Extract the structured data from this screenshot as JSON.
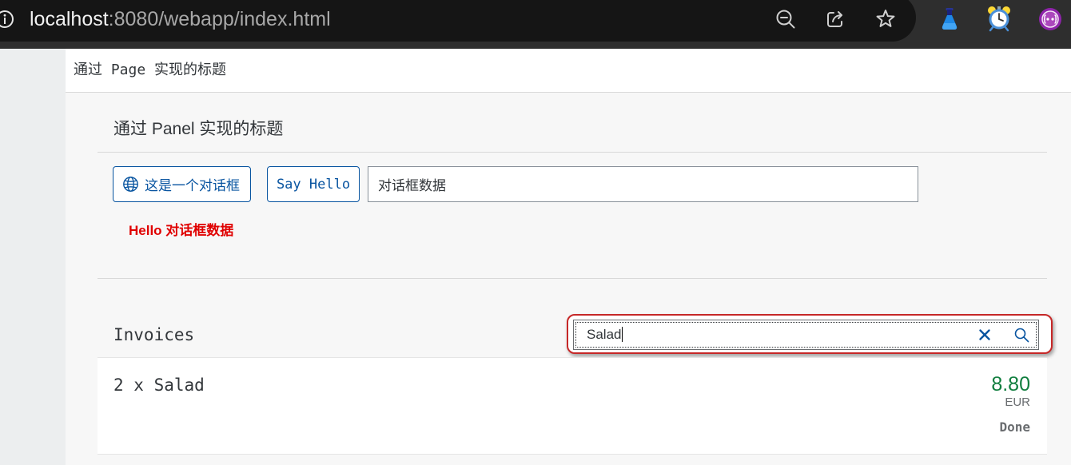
{
  "browser": {
    "url_host": "localhost",
    "url_path": ":8080/webapp/index.html",
    "icons": {
      "site_info": "info-icon",
      "zoom": "zoom-out-icon",
      "share": "share-icon",
      "favorite": "star-icon",
      "extensions": [
        "flask-extension-icon",
        "alarm-clock-extension-icon",
        "purple-face-extension-icon"
      ]
    }
  },
  "page": {
    "title": "通过 Page 实现的标题"
  },
  "panel": {
    "title": "通过 Panel 实现的标题",
    "dialog_button": {
      "icon": "globe-icon",
      "label": "这是一个对话框"
    },
    "say_hello_button": {
      "label": "Say Hello"
    },
    "input_value": "对话框数据",
    "greeting": "Hello 对话框数据"
  },
  "invoices": {
    "title": "Invoices",
    "search": {
      "value": "Salad",
      "clear_icon": "clear-icon",
      "search_icon": "search-icon"
    },
    "items": [
      {
        "title": "2 x Salad",
        "amount": "8.80",
        "currency": "EUR",
        "status": "Done"
      }
    ]
  },
  "colors": {
    "accent": "#0854a0",
    "greeting_text": "#e00000",
    "amount_positive": "#107e3e",
    "muted_text": "#6a6d70",
    "highlight_outline": "#c62828"
  }
}
